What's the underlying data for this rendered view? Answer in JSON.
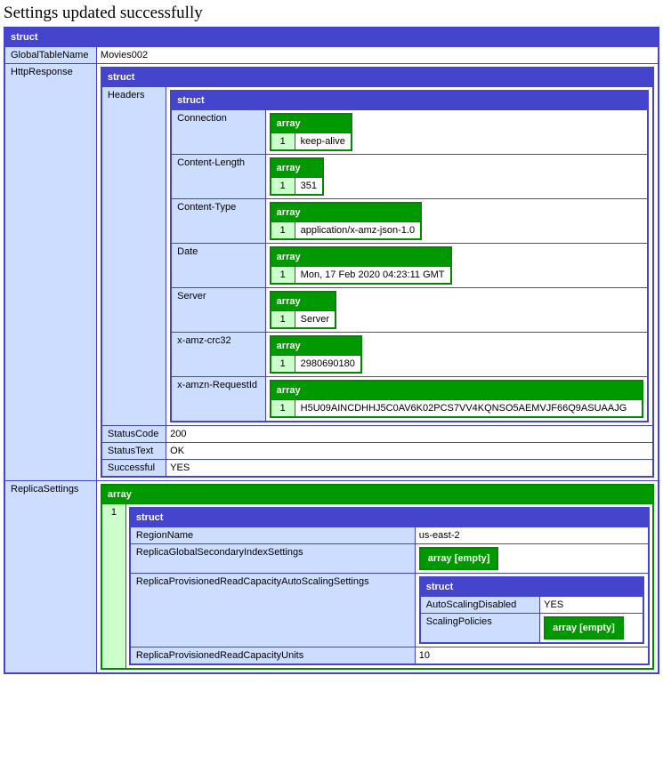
{
  "title": "Settings updated successfully",
  "labels": {
    "struct": "struct",
    "array": "array",
    "array_empty": "array [empty]"
  },
  "root": {
    "GlobalTableName": {
      "key": "GlobalTableName",
      "value": "Movies002"
    },
    "HttpResponse": {
      "key": "HttpResponse",
      "Headers": {
        "key": "Headers",
        "items": {
          "Connection": {
            "key": "Connection",
            "index": "1",
            "value": "keep-alive"
          },
          "ContentLength": {
            "key": "Content-Length",
            "index": "1",
            "value": "351"
          },
          "ContentType": {
            "key": "Content-Type",
            "index": "1",
            "value": "application/x-amz-json-1.0"
          },
          "Date": {
            "key": "Date",
            "index": "1",
            "value": "Mon, 17 Feb 2020 04:23:11 GMT"
          },
          "Server": {
            "key": "Server",
            "index": "1",
            "value": "Server"
          },
          "xAmzCrc32": {
            "key": "x-amz-crc32",
            "index": "1",
            "value": "2980690180"
          },
          "xAmznRequestId": {
            "key": "x-amzn-RequestId",
            "index": "1",
            "value": "H5U09AINCDHHJ5C0AV6K02PCS7VV4KQNSO5AEMVJF66Q9ASUAAJG"
          }
        }
      },
      "StatusCode": {
        "key": "StatusCode",
        "value": "200"
      },
      "StatusText": {
        "key": "StatusText",
        "value": "OK"
      },
      "Successful": {
        "key": "Successful",
        "value": "YES"
      }
    },
    "ReplicaSettings": {
      "key": "ReplicaSettings",
      "index": "1",
      "item": {
        "RegionName": {
          "key": "RegionName",
          "value": "us-east-2"
        },
        "ReplicaGSI": {
          "key": "ReplicaGlobalSecondaryIndexSettings"
        },
        "ReplicaAutoScaling": {
          "key": "ReplicaProvisionedReadCapacityAutoScalingSettings",
          "AutoScalingDisabled": {
            "key": "AutoScalingDisabled",
            "value": "YES"
          },
          "ScalingPolicies": {
            "key": "ScalingPolicies"
          }
        },
        "ReplicaReadUnits": {
          "key": "ReplicaProvisionedReadCapacityUnits",
          "value": "10"
        }
      }
    }
  }
}
